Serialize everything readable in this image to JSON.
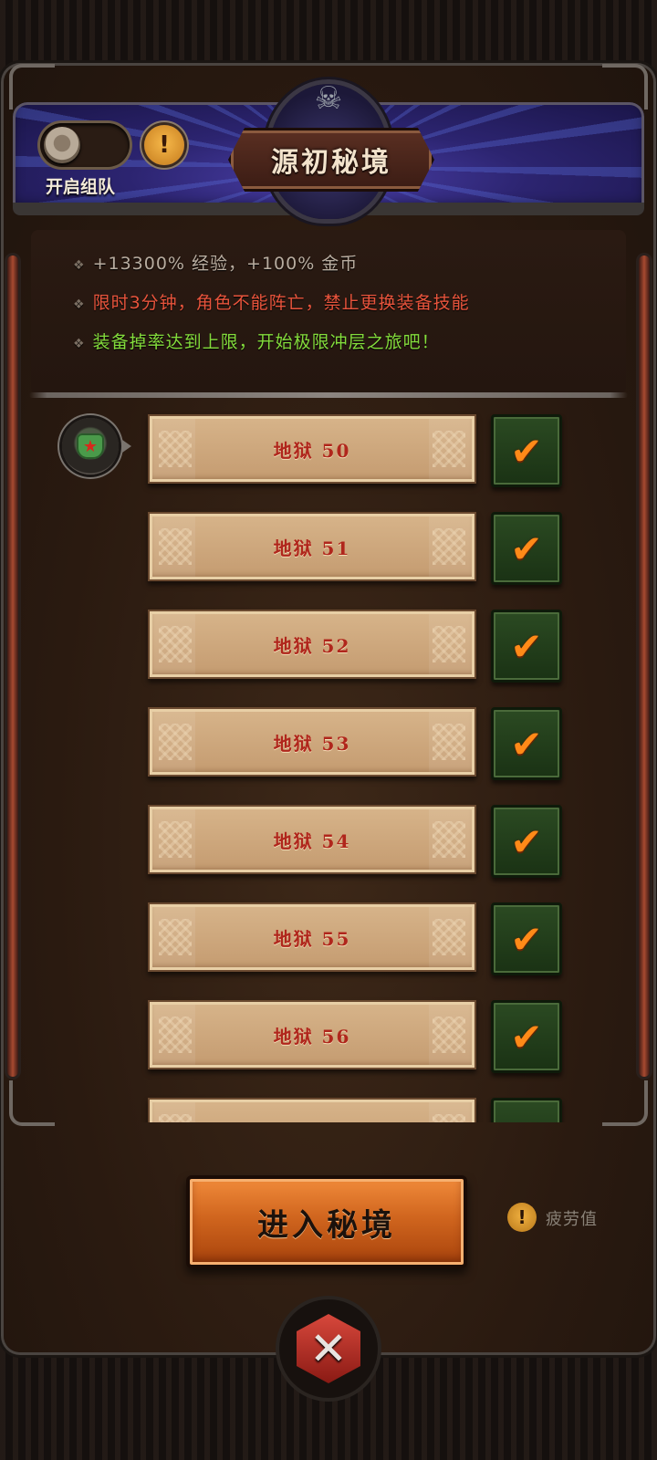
{
  "header": {
    "title": "源初秘境",
    "team_toggle_label": "开启组队",
    "info_symbol": "!"
  },
  "bonus_info": {
    "line1": "+13300% 经验，+100% 金币",
    "line2": "限时3分钟，角色不能阵亡，禁止更换装备技能",
    "line3": "装备掉率达到上限，开始极限冲层之旅吧！",
    "bullet": "❖"
  },
  "levels": [
    {
      "label": "地狱 50",
      "completed": true,
      "current": true
    },
    {
      "label": "地狱 51",
      "completed": true
    },
    {
      "label": "地狱 52",
      "completed": true
    },
    {
      "label": "地狱 53",
      "completed": true
    },
    {
      "label": "地狱 54",
      "completed": true
    },
    {
      "label": "地狱 55",
      "completed": true
    },
    {
      "label": "地狱 56",
      "completed": true
    },
    {
      "label": "",
      "completed": true
    }
  ],
  "actions": {
    "enter_label": "进入秘境",
    "fatigue_label": "疲劳值",
    "fatigue_symbol": "!"
  },
  "colors": {
    "line1": "#b9ada0",
    "line2": "#e8543c",
    "line3": "#84dc3c",
    "level_text": "#b0261c",
    "check": "#ff8a18",
    "enter_button": "#d0651e",
    "header_bg": "#2c2470"
  },
  "icons": {
    "skull": "skull-icon",
    "check": "checkmark-icon",
    "marker": "chest-armor-icon",
    "close": "crossed-swords-icon"
  }
}
